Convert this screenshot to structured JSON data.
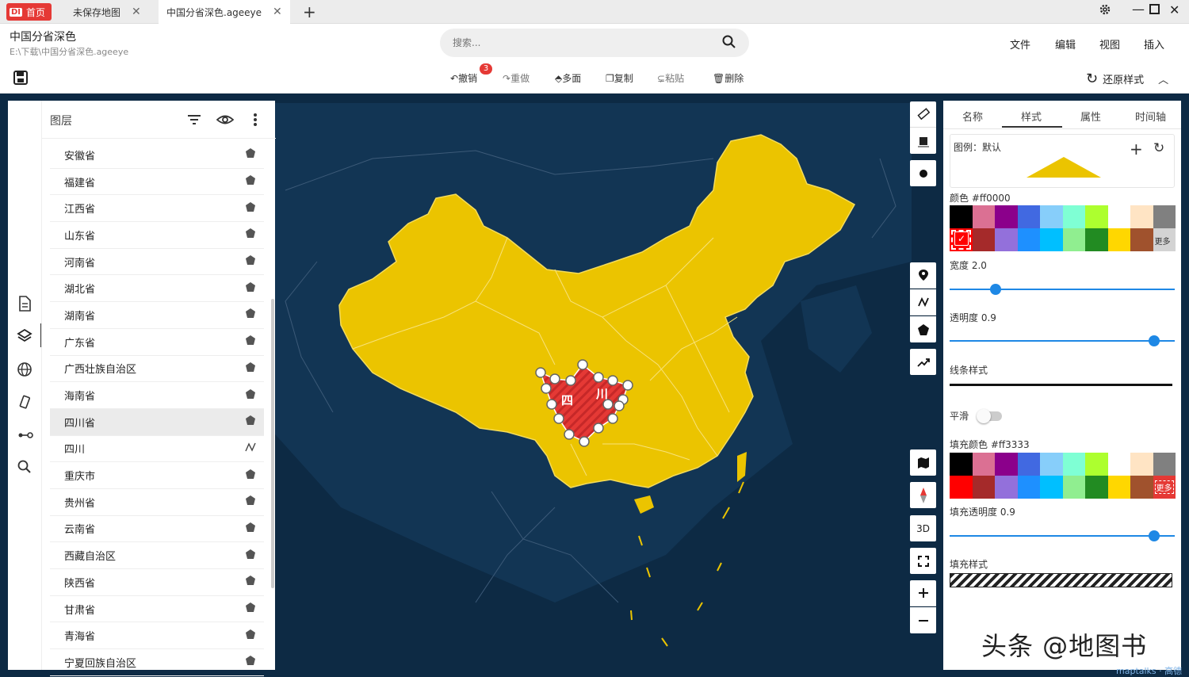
{
  "tabs": {
    "home_logo": "DI",
    "home_label": "首页",
    "unsaved": "未保存地图",
    "active": "中国分省深色.ageeye"
  },
  "header": {
    "title": "中国分省深色",
    "path": "E:\\下载\\中国分省深色.ageeye",
    "search_placeholder": "搜索...",
    "menu": [
      "文件",
      "编辑",
      "视图",
      "插入"
    ]
  },
  "toolbar": {
    "undo": "撤销",
    "undo_count": "3",
    "redo": "重做",
    "multi": "多面",
    "copy": "复制",
    "paste": "粘贴",
    "delete": "删除",
    "restore": "还原样式"
  },
  "layers": {
    "title": "图层",
    "items": [
      {
        "name": "安徽省",
        "icon": "pentagon-icon"
      },
      {
        "name": "福建省",
        "icon": "pentagon-icon"
      },
      {
        "name": "江西省",
        "icon": "pentagon-icon"
      },
      {
        "name": "山东省",
        "icon": "pentagon-icon"
      },
      {
        "name": "河南省",
        "icon": "pentagon-icon"
      },
      {
        "name": "湖北省",
        "icon": "pentagon-icon"
      },
      {
        "name": "湖南省",
        "icon": "pentagon-icon"
      },
      {
        "name": "广东省",
        "icon": "pentagon-icon"
      },
      {
        "name": "广西壮族自治区",
        "icon": "pentagon-icon"
      },
      {
        "name": "海南省",
        "icon": "pentagon-icon"
      },
      {
        "name": "四川省",
        "icon": "pentagon-icon",
        "selected": true
      },
      {
        "name": "四川",
        "icon": "polyline-icon"
      },
      {
        "name": "重庆市",
        "icon": "pentagon-icon"
      },
      {
        "name": "贵州省",
        "icon": "pentagon-icon"
      },
      {
        "name": "云南省",
        "icon": "pentagon-icon"
      },
      {
        "name": "西藏自治区",
        "icon": "pentagon-icon"
      },
      {
        "name": "陕西省",
        "icon": "pentagon-icon"
      },
      {
        "name": "甘肃省",
        "icon": "pentagon-icon"
      },
      {
        "name": "青海省",
        "icon": "pentagon-icon"
      },
      {
        "name": "宁夏回族自治区",
        "icon": "pentagon-icon"
      }
    ]
  },
  "map": {
    "label_si": "四",
    "label_chuan": "川",
    "tool_3d": "3D",
    "attribution": "maptalks · 高德",
    "fill_color": "#ebc400",
    "highlight_color": "#ff3333"
  },
  "style_panel": {
    "tabs": [
      "名称",
      "样式",
      "属性",
      "时间轴"
    ],
    "active_tab": "样式",
    "legend": "图例：默认",
    "color_label": "颜色 #ff0000",
    "width_label": "宽度 2.0",
    "width_value": 2.0,
    "opacity_label": "透明度 0.9",
    "opacity_value": 0.9,
    "line_style_label": "线条样式",
    "smooth_label": "平滑",
    "fill_color_label": "填充颜色 #ff3333",
    "fill_opacity_label": "填充透明度 0.9",
    "fill_opacity_value": 0.9,
    "fill_style_label": "填充样式",
    "more_label": "更多",
    "palette_row1": [
      "#000000",
      "#db7093",
      "#8b008b",
      "#4169e1",
      "#87cefa",
      "#7fffd4",
      "#adff2f",
      "#ffffff",
      "#ffe4c4",
      "#808080"
    ],
    "line_palette_row2": [
      "#ff0000",
      "#a52a2a",
      "#9370db",
      "#1e90ff",
      "#00bfff",
      "#90ee90",
      "#228b22",
      "#ffd700",
      "#a0522d",
      "#d3d3d3"
    ],
    "fill_palette_row2": [
      "#ff0000",
      "#a52a2a",
      "#9370db",
      "#1e90ff",
      "#00bfff",
      "#90ee90",
      "#228b22",
      "#ffd700",
      "#a0522d",
      "#e53935"
    ]
  },
  "watermark": "头条 @地图书"
}
